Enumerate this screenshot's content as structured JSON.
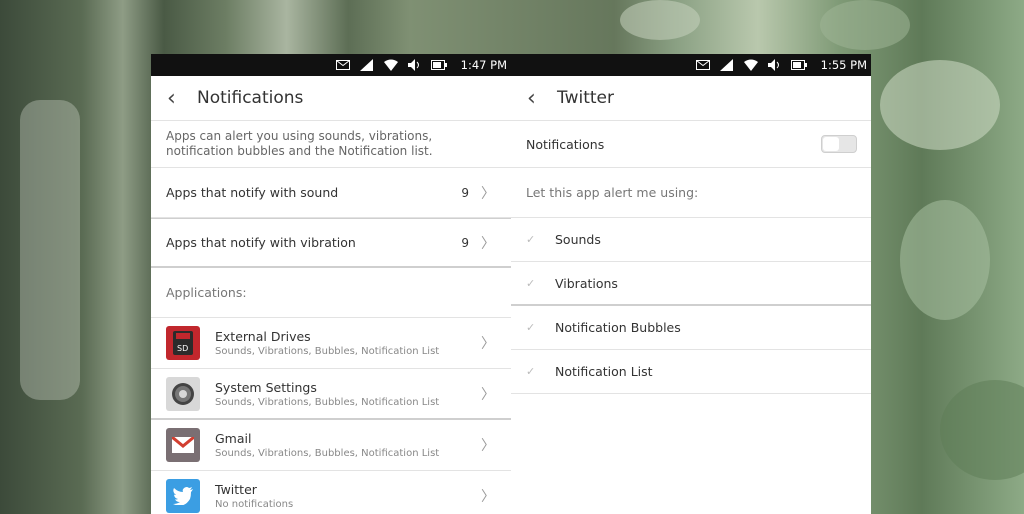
{
  "left": {
    "status_time": "1:47 PM",
    "title": "Notifications",
    "description": "Apps can alert you using sounds, vibrations, notification bubbles and the Notification list.",
    "sound_row": {
      "label": "Apps that notify with sound",
      "count": "9"
    },
    "vibration_row": {
      "label": "Apps that notify with vibration",
      "count": "9"
    },
    "section_label": "Applications:",
    "apps": [
      {
        "name": "External Drives",
        "sub": "Sounds, Vibrations, Bubbles, Notification List",
        "icon": "sd-card-icon",
        "color": "#c1272d",
        "badge": "SD"
      },
      {
        "name": "System Settings",
        "sub": "Sounds, Vibrations, Bubbles, Notification List",
        "icon": "gear-icon",
        "color": "#d8d8d8"
      },
      {
        "name": "Gmail",
        "sub": "Sounds, Vibrations, Bubbles, Notification List",
        "icon": "gmail-icon",
        "color": "#7a6f73"
      },
      {
        "name": "Twitter",
        "sub": "No notifications",
        "icon": "twitter-icon",
        "color": "#3b9ee3"
      }
    ]
  },
  "right": {
    "status_time": "1:55 PM",
    "title": "Twitter",
    "notifications_label": "Notifications",
    "notifications_enabled": false,
    "alert_label": "Let this app alert me using:",
    "options": [
      {
        "label": "Sounds"
      },
      {
        "label": "Vibrations"
      },
      {
        "label": "Notification Bubbles"
      },
      {
        "label": "Notification List"
      }
    ]
  }
}
